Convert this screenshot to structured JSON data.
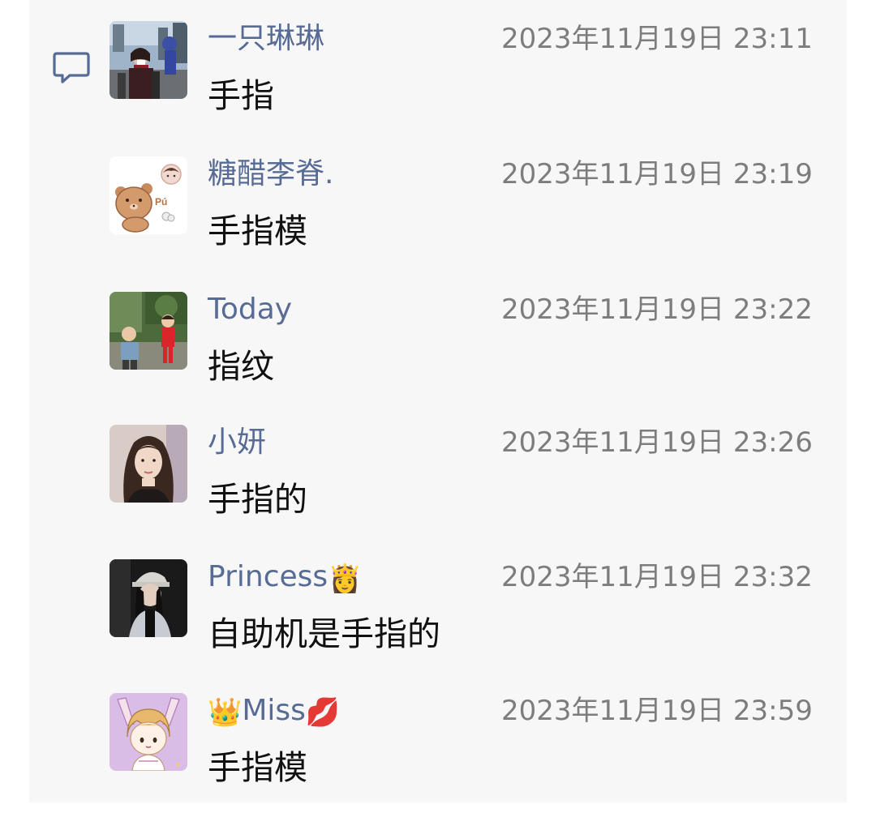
{
  "comments": [
    {
      "name": "一只琳琳",
      "name_prefix": "",
      "name_suffix": "",
      "time": "2023年11月19日 23:11",
      "text": "手指",
      "avatar": "photo-woman-red-scarf-street"
    },
    {
      "name": "糖醋李脊.",
      "name_prefix": "",
      "name_suffix": "",
      "time": "2023年11月19日 23:19",
      "text": "手指模",
      "avatar": "cartoon-bear-sticker"
    },
    {
      "name": "Today",
      "name_prefix": "",
      "name_suffix": "",
      "time": "2023年11月19日 23:22",
      "text": "指纹",
      "avatar": "photo-children-garden"
    },
    {
      "name": "小妍",
      "name_prefix": "",
      "name_suffix": "",
      "time": "2023年11月19日 23:26",
      "text": "手指的",
      "avatar": "photo-woman-portrait"
    },
    {
      "name": "Princess",
      "name_prefix": "",
      "name_suffix": "👸",
      "time": "2023年11月19日 23:32",
      "text": "自助机是手指的",
      "avatar": "photo-girl-cap-dark"
    },
    {
      "name": "Miss",
      "name_prefix": "👑",
      "name_suffix": "💋",
      "time": "2023年11月19日 23:59",
      "text": "手指模",
      "avatar": "cartoon-anime-girl-purple"
    }
  ],
  "icons": {
    "comment": "comment-bubble-icon"
  },
  "colors": {
    "name": "#576b95",
    "time": "#7d7d7d",
    "text": "#111111",
    "panel_bg": "#f7f7f7",
    "icon": "#576b95"
  }
}
